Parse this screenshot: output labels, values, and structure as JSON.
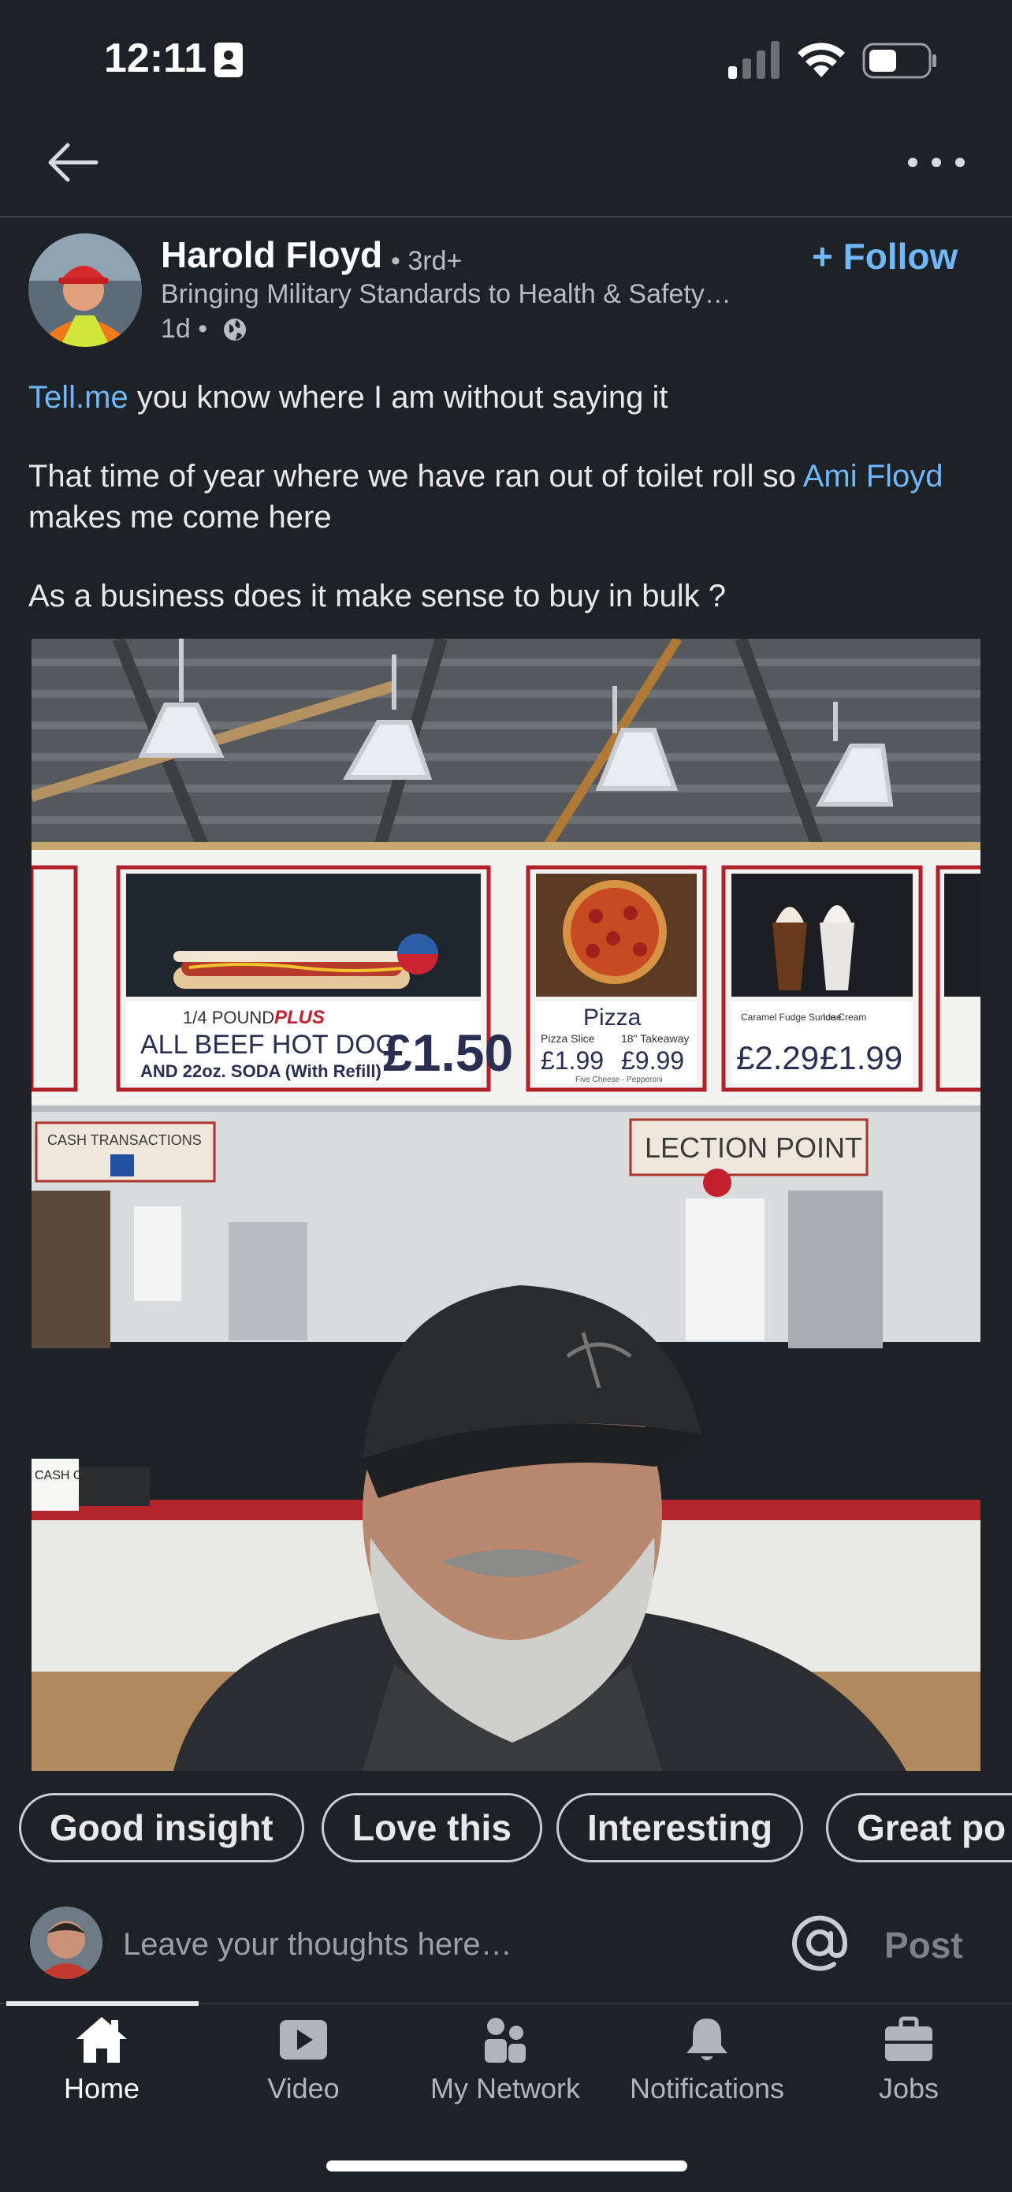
{
  "status_bar": {
    "time": "12:11"
  },
  "post": {
    "author": {
      "name": "Harold Floyd",
      "degree": "• 3rd+",
      "headline": "Bringing Military Standards to Health & Safety…",
      "time": "1d •"
    },
    "follow_label": "+ Follow",
    "text": {
      "p1_link": "Tell.me",
      "p1_rest": " you know where I am without saying it",
      "p2_a": "That time of year where we have ran out of toilet roll so ",
      "p2_mention": "Ami Floyd",
      "p2_b": " makes me come here",
      "p3": "As a business does it make sense to buy in bulk ?"
    },
    "image": {
      "sign_hotdog_top": "1/4 POUND",
      "sign_hotdog_plus": "PLUS",
      "sign_hotdog_main": "ALL BEEF HOT DOG",
      "sign_hotdog_soda": "AND 22oz. SODA (With Refill)",
      "sign_hotdog_price": "£1.50",
      "sign_pizza_title": "Pizza",
      "sign_pizza_slice": "Pizza Slice",
      "sign_pizza_takeaway": "18\" Takeaway",
      "sign_pizza_slice_price": "£1.99",
      "sign_pizza_takeaway_price": "£9.99",
      "sign_pizza_note": "Five Cheese · Pepperoni",
      "sign_sundae_title": "Caramel Fudge Sundae",
      "sign_icecream_title": "Ice Cream",
      "sign_sundae_price": "£2.29",
      "sign_icecream_price": "£1.99",
      "sign_cash": "CASH TRANSACTIONS",
      "sign_collection": "LECTION POINT",
      "sign_cash_only": "CASH ONLY"
    }
  },
  "reactions": [
    "Good insight",
    "Love this",
    "Interesting",
    "Great po"
  ],
  "comment": {
    "placeholder": "Leave your thoughts here…",
    "post_label": "Post"
  },
  "tabs": [
    {
      "label": "Home",
      "icon": "home-icon",
      "active": true
    },
    {
      "label": "Video",
      "icon": "video-icon"
    },
    {
      "label": "My Network",
      "icon": "network-icon"
    },
    {
      "label": "Notifications",
      "icon": "bell-icon"
    },
    {
      "label": "Jobs",
      "icon": "briefcase-icon"
    }
  ],
  "colors": {
    "background": "#1d2226",
    "accent": "#71b7fb",
    "text": "#e9e9e9",
    "muted": "#b8bcbf"
  }
}
